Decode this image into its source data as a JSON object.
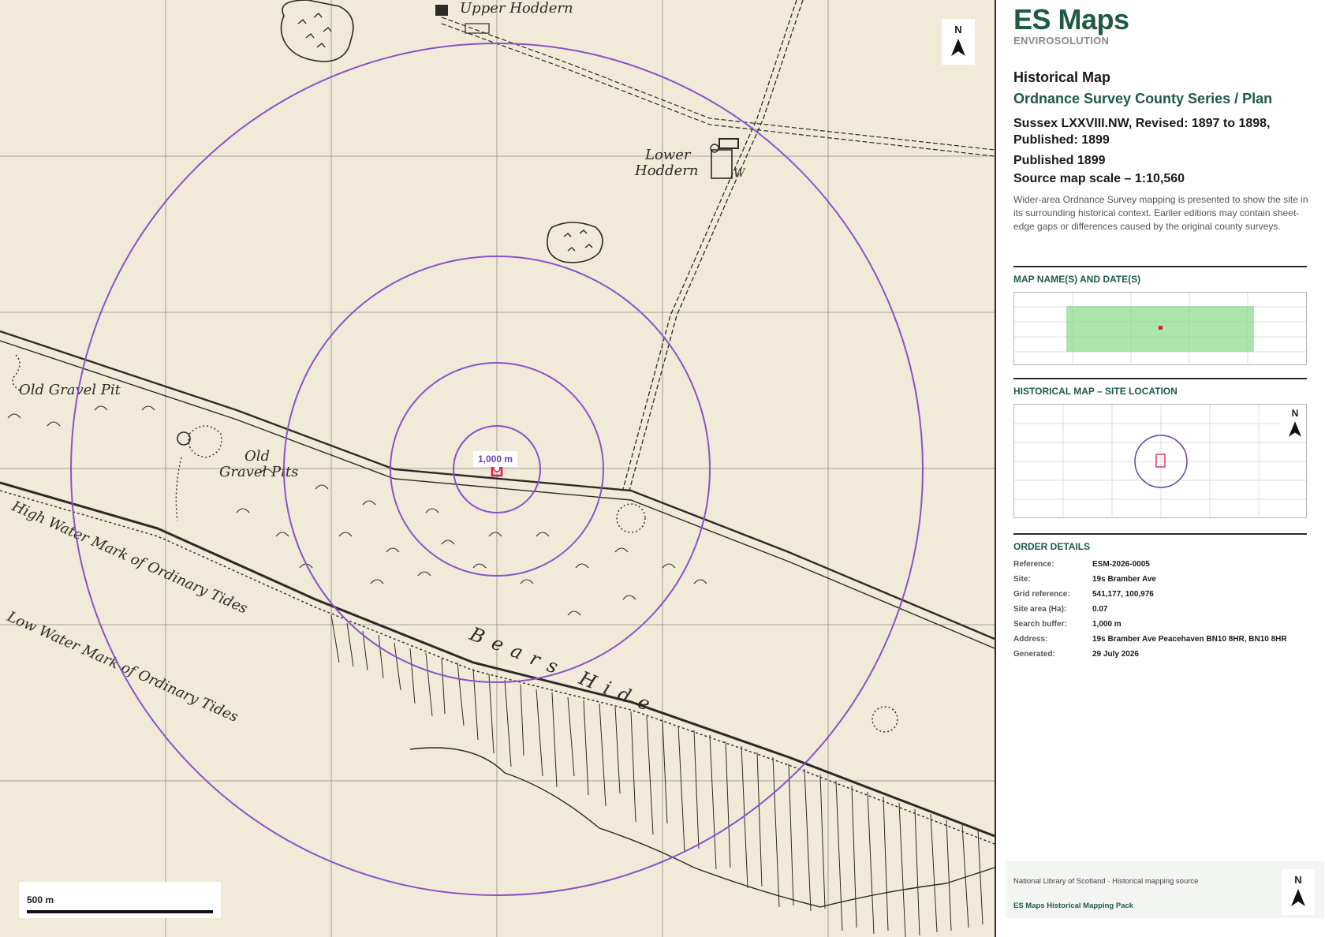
{
  "map": {
    "north_label": "N",
    "buffer_label": "1,000 m",
    "scale_label": "500 m",
    "place_labels": {
      "upper_hoddern": "Upper Hoddern",
      "lower_hoddern_1": "Lower",
      "lower_hoddern_2": "Hoddern",
      "well": "W",
      "old_gravel_pit": "Old Gravel Pit",
      "old_gravel_pits_1": "Old",
      "old_gravel_pits_2": "Gravel Pits",
      "high_water": "High Water Mark of Ordinary Tides",
      "low_water": "Low Water Mark of Ordinary Tides",
      "bears_hide": "Bears Hide"
    },
    "colors": {
      "buffer_ring": "#8a52c9",
      "site_marker": "#d4204a",
      "paper": "#f1ead9"
    }
  },
  "panel": {
    "brand": {
      "title": "ES Maps",
      "subtitle": "ENVIROSOLUTION"
    },
    "historical": {
      "heading": "Historical Map",
      "series": "Ordnance Survey County Series / Plan",
      "sheet": "Sussex LXXVIII.NW, Revised: 1897 to 1898, Published: 1899",
      "published": "Published 1899",
      "scale": "Source map scale – 1:10,560",
      "description": "Wider-area Ordnance Survey mapping is presented to show the site in its surrounding historical context. Earlier editions may contain sheet-edge gaps or differences caused by the original county surveys."
    },
    "sections": {
      "map_names": "MAP NAME(S) AND DATE(S)",
      "site_location": "HISTORICAL MAP – SITE LOCATION",
      "order_details": "ORDER DETAILS"
    },
    "site_location_north": "N",
    "order": {
      "reference_label": "Reference:",
      "reference": "ESM-2026-0005",
      "site_label": "Site:",
      "site": "19s Bramber Ave",
      "grid_label": "Grid reference:",
      "grid": "541,177, 100,976",
      "area_label": "Site area (Ha):",
      "area": "0.07",
      "buffer_label": "Search buffer:",
      "buffer": "1,000 m",
      "address_label": "Address:",
      "address": "19s Bramber Ave Peacehaven BN10 8HR, BN10 8HR",
      "generated_label": "Generated:",
      "generated": "29 July 2026"
    },
    "footer": {
      "source": "National Library of Scotland · Historical mapping source",
      "pack": "ES Maps Historical Mapping Pack",
      "north": "N"
    },
    "colors": {
      "brand_green": "#1f5a41",
      "coverage_fill": "#8fdc8f"
    }
  }
}
